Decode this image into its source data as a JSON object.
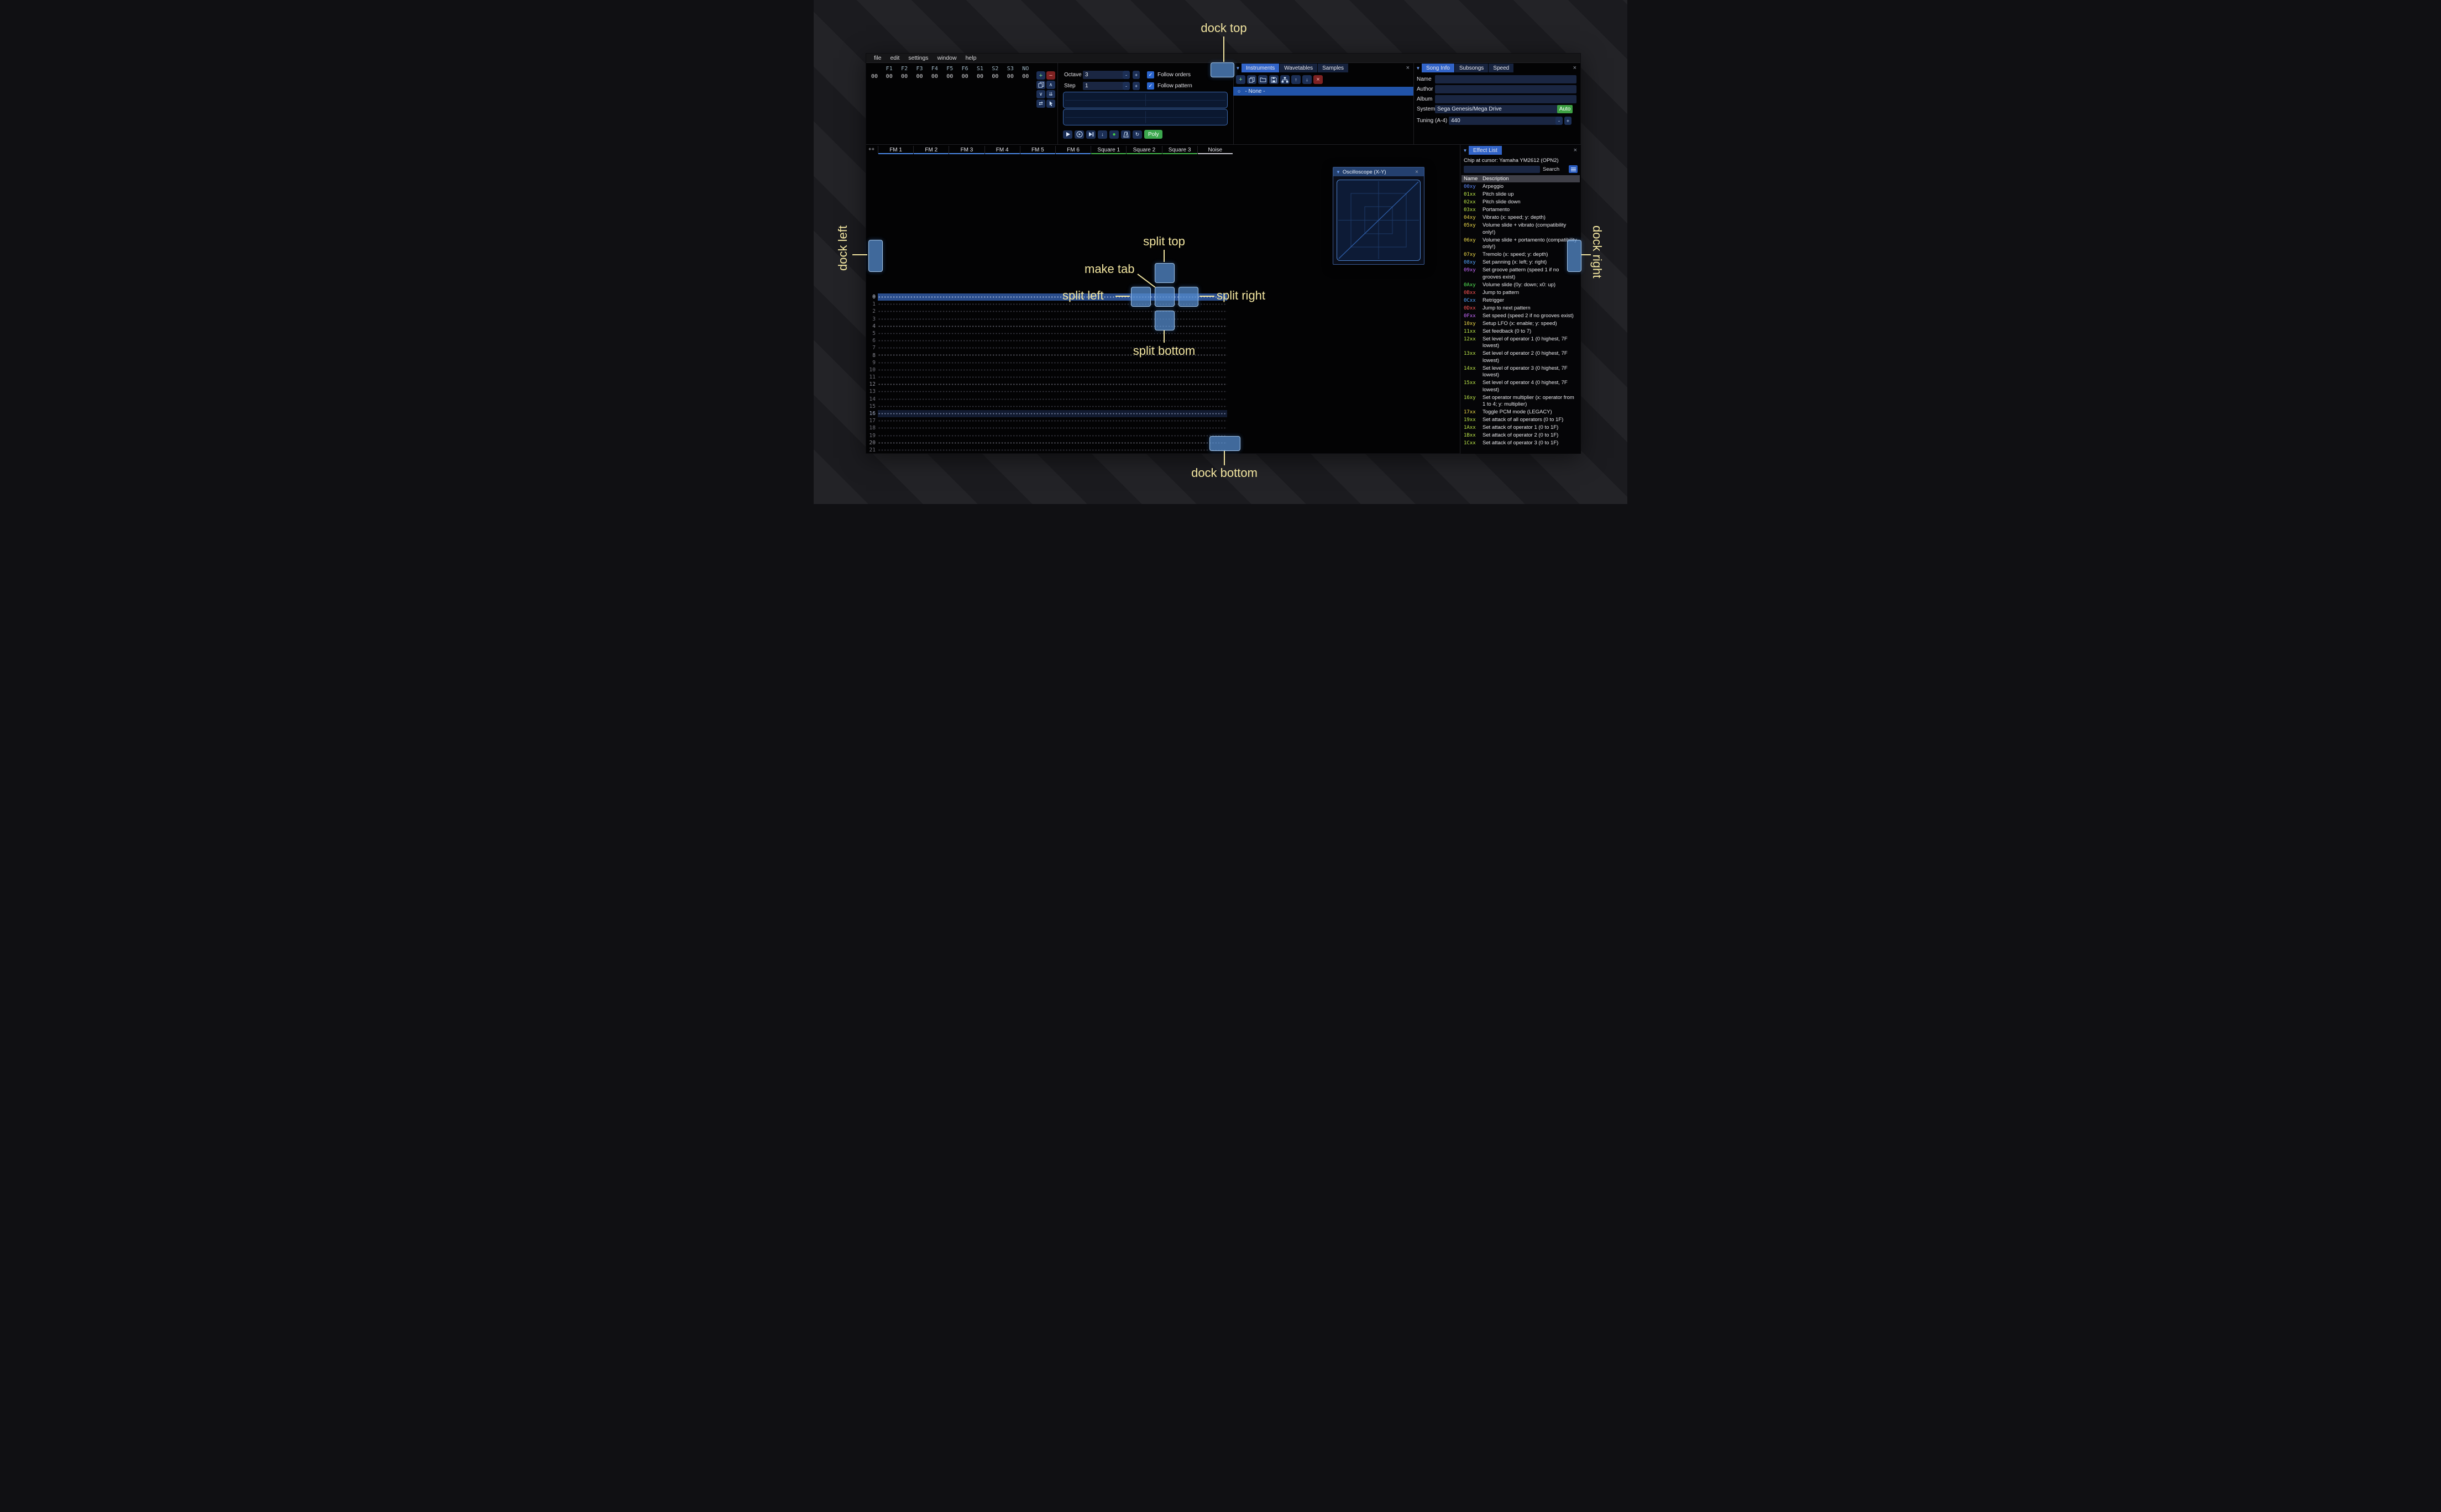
{
  "overlay": {
    "dock_top": "dock top",
    "dock_bottom": "dock bottom",
    "dock_left": "dock left",
    "dock_right": "dock right",
    "split_top": "split top",
    "split_bottom": "split bottom",
    "split_left": "split left",
    "split_right": "split right",
    "make_tab": "make tab",
    "label_color": "#f2e5a0",
    "target_color": "#568ccd"
  },
  "menu": {
    "items": [
      "file",
      "edit",
      "settings",
      "window",
      "help"
    ]
  },
  "orders": {
    "row_index": "00",
    "columns": [
      "F1",
      "F2",
      "F3",
      "F4",
      "F5",
      "F6",
      "S1",
      "S2",
      "S3",
      "NO"
    ],
    "values": [
      "00",
      "00",
      "00",
      "00",
      "00",
      "00",
      "00",
      "00",
      "00",
      "00"
    ],
    "button_icons": [
      "add",
      "remove",
      "duplicate",
      "move-up",
      "move-down",
      "duplicate-to-end",
      "exchange",
      "edit-cursor"
    ]
  },
  "controls": {
    "octave_label": "Octave",
    "octave_value": "3",
    "step_label": "Step",
    "step_value": "1",
    "minus_label": "-",
    "plus_label": "+",
    "follow_orders_label": "Follow orders",
    "follow_pattern_label": "Follow pattern",
    "playbar_icons": [
      "play",
      "play-from-start",
      "step-one-row",
      "move-down",
      "record",
      "metronome",
      "repeat-pattern"
    ],
    "poly_label": "Poly"
  },
  "instruments": {
    "tabs": [
      {
        "label": "Instruments",
        "state": "active"
      },
      {
        "label": "Wavetables",
        "state": ""
      },
      {
        "label": "Samples",
        "state": ""
      }
    ],
    "toolbar_icons": [
      "add",
      "duplicate",
      "open",
      "save",
      "organize",
      "move-up",
      "move-down",
      "delete"
    ],
    "selected_item": "- None -"
  },
  "song_info": {
    "tabs": [
      {
        "label": "Song Info",
        "state": "active"
      },
      {
        "label": "Subsongs",
        "state": ""
      },
      {
        "label": "Speed",
        "state": ""
      }
    ],
    "name_label": "Name",
    "name_value": "",
    "author_label": "Author",
    "author_value": "",
    "album_label": "Album",
    "album_value": "",
    "system_label": "System",
    "system_value": "Sega Genesis/Mega Drive",
    "auto_label": "Auto",
    "tuning_label": "Tuning (A-4)",
    "tuning_value": "440"
  },
  "pattern": {
    "corner_label": "++",
    "channels": [
      {
        "name": "FM 1",
        "color": "#4a86e4"
      },
      {
        "name": "FM 2",
        "color": "#4a86e4"
      },
      {
        "name": "FM 3",
        "color": "#4a86e4"
      },
      {
        "name": "FM 4",
        "color": "#4a86e4"
      },
      {
        "name": "FM 5",
        "color": "#4a86e4"
      },
      {
        "name": "FM 6",
        "color": "#4a86e4"
      },
      {
        "name": "Square 1",
        "color": "#42b449"
      },
      {
        "name": "Square 2",
        "color": "#42b449"
      },
      {
        "name": "Square 3",
        "color": "#42b449"
      },
      {
        "name": "Noise",
        "color": "#c4c4cc"
      }
    ],
    "rows": [
      {
        "n": "0",
        "t": "cursor"
      },
      {
        "n": "1",
        "t": ""
      },
      {
        "n": "2",
        "t": ""
      },
      {
        "n": "3",
        "t": ""
      },
      {
        "n": "4",
        "t": "bar"
      },
      {
        "n": "5",
        "t": ""
      },
      {
        "n": "6",
        "t": ""
      },
      {
        "n": "7",
        "t": ""
      },
      {
        "n": "8",
        "t": "bar"
      },
      {
        "n": "9",
        "t": ""
      },
      {
        "n": "10",
        "t": ""
      },
      {
        "n": "11",
        "t": ""
      },
      {
        "n": "12",
        "t": "bar"
      },
      {
        "n": "13",
        "t": ""
      },
      {
        "n": "14",
        "t": ""
      },
      {
        "n": "15",
        "t": ""
      },
      {
        "n": "16",
        "t": "beat"
      },
      {
        "n": "17",
        "t": ""
      },
      {
        "n": "18",
        "t": ""
      },
      {
        "n": "19",
        "t": ""
      },
      {
        "n": "20",
        "t": "bar"
      },
      {
        "n": "21",
        "t": ""
      }
    ]
  },
  "oscilloscope": {
    "title": "Oscilloscope (X-Y)"
  },
  "effect_list": {
    "tab_label": "Effect List",
    "chip_line": "Chip at cursor: Yamaha YM2612 (OPN2)",
    "search_label": "Search",
    "col_name": "Name",
    "col_desc": "Description",
    "effects": [
      {
        "code": "00xy",
        "color": "#5f8cff",
        "desc": "Arpeggio"
      },
      {
        "code": "01xx",
        "color": "#bde84a",
        "desc": "Pitch slide up"
      },
      {
        "code": "02xx",
        "color": "#bde84a",
        "desc": "Pitch slide down"
      },
      {
        "code": "03xx",
        "color": "#bde84a",
        "desc": "Portamento"
      },
      {
        "code": "04xy",
        "color": "#f0dc4a",
        "desc": "Vibrato (x: speed; y: depth)"
      },
      {
        "code": "05xy",
        "color": "#f0dc4a",
        "desc": "Volume slide + vibrato (compatibility only!)"
      },
      {
        "code": "06xy",
        "color": "#f0dc4a",
        "desc": "Volume slide + portamento (compatibility only!)"
      },
      {
        "code": "07xy",
        "color": "#f0dc4a",
        "desc": "Tremolo (x: speed; y: depth)"
      },
      {
        "code": "08xy",
        "color": "#55a6ff",
        "desc": "Set panning (x: left; y: right)"
      },
      {
        "code": "09xy",
        "color": "#c86aff",
        "desc": "Set groove pattern (speed 1 if no grooves exist)"
      },
      {
        "code": "0Axy",
        "color": "#55e855",
        "desc": "Volume slide (0y: down; x0: up)"
      },
      {
        "code": "0Bxx",
        "color": "#ff5555",
        "desc": "Jump to pattern"
      },
      {
        "code": "0Cxx",
        "color": "#55a6ff",
        "desc": "Retrigger"
      },
      {
        "code": "0Dxx",
        "color": "#ff5555",
        "desc": "Jump to next pattern"
      },
      {
        "code": "0Fxx",
        "color": "#c86aff",
        "desc": "Set speed (speed 2 if no grooves exist)"
      },
      {
        "code": "10xy",
        "color": "#f0dc4a",
        "desc": "Setup LFO (x: enable; y: speed)"
      },
      {
        "code": "11xx",
        "color": "#bde84a",
        "desc": "Set feedback (0 to 7)"
      },
      {
        "code": "12xx",
        "color": "#bde84a",
        "desc": "Set level of operator 1 (0 highest, 7F lowest)"
      },
      {
        "code": "13xx",
        "color": "#bde84a",
        "desc": "Set level of operator 2 (0 highest, 7F lowest)"
      },
      {
        "code": "14xx",
        "color": "#bde84a",
        "desc": "Set level of operator 3 (0 highest, 7F lowest)"
      },
      {
        "code": "15xx",
        "color": "#bde84a",
        "desc": "Set level of operator 4 (0 highest, 7F lowest)"
      },
      {
        "code": "16xy",
        "color": "#bde84a",
        "desc": "Set operator multiplier (x: operator from 1 to 4; y: multiplier)"
      },
      {
        "code": "17xx",
        "color": "#f0dc4a",
        "desc": "Toggle PCM mode (LEGACY)"
      },
      {
        "code": "19xx",
        "color": "#bde84a",
        "desc": "Set attack of all operators (0 to 1F)"
      },
      {
        "code": "1Axx",
        "color": "#bde84a",
        "desc": "Set attack of operator 1 (0 to 1F)"
      },
      {
        "code": "1Bxx",
        "color": "#bde84a",
        "desc": "Set attack of operator 2 (0 to 1F)"
      },
      {
        "code": "1Cxx",
        "color": "#bde84a",
        "desc": "Set attack of operator 3 (0 to 1F)"
      }
    ]
  }
}
